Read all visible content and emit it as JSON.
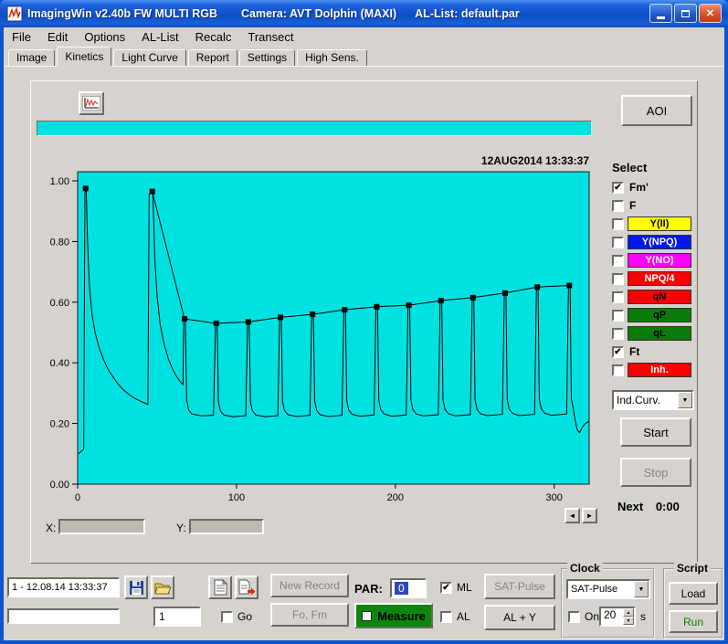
{
  "window": {
    "title": "ImagingWin v2.40b  FW MULTI RGB",
    "camera": "Camera: AVT Dolphin (MAXI)",
    "al_list": "AL-List: default.par"
  },
  "menu": {
    "items": [
      "File",
      "Edit",
      "Options",
      "AL-List",
      "Recalc",
      "Transect"
    ]
  },
  "tabs": {
    "items": [
      "Image",
      "Kinetics",
      "Light Curve",
      "Report",
      "Settings",
      "High Sens."
    ],
    "active": "Kinetics"
  },
  "toolbar": {
    "aoi_label": "AOI"
  },
  "chart_data": {
    "type": "line",
    "timestamp": "12AUG2014  13:33:37",
    "plot_bg": "#00E2E2",
    "xlim": [
      0,
      322
    ],
    "ylim": [
      0,
      1.0
    ],
    "x_ticks": [
      [
        0,
        "0"
      ],
      [
        100,
        "100"
      ],
      [
        200,
        "200"
      ],
      [
        300,
        "300"
      ]
    ],
    "y_ticks": [
      [
        0,
        "0.00"
      ],
      [
        0.2,
        "0.20"
      ],
      [
        0.4,
        "0.40"
      ],
      [
        0.6,
        "0.60"
      ],
      [
        0.8,
        "0.80"
      ],
      [
        1.0,
        "1.00"
      ]
    ],
    "series_names": [
      "Fm'",
      "Ft"
    ],
    "fm_line_from": 1,
    "fm_points": [
      [
        5,
        0.975
      ],
      [
        47,
        0.965
      ],
      [
        67.3,
        0.545
      ],
      [
        87.3,
        0.53
      ],
      [
        107.5,
        0.535
      ],
      [
        127.7,
        0.55
      ],
      [
        147.9,
        0.56
      ],
      [
        168.1,
        0.575
      ],
      [
        188.3,
        0.585
      ],
      [
        208.5,
        0.59
      ],
      [
        228.7,
        0.605
      ],
      [
        248.9,
        0.615
      ],
      [
        269.1,
        0.63
      ],
      [
        289.3,
        0.65
      ],
      [
        309.5,
        0.655
      ]
    ],
    "ft_trace": [
      [
        0.5,
        0.1
      ],
      [
        3.8,
        0.115
      ],
      [
        4.6,
        0.96
      ],
      [
        5.4,
        0.975
      ],
      [
        6.2,
        0.8
      ],
      [
        7.5,
        0.65
      ],
      [
        9,
        0.56
      ],
      [
        11,
        0.5
      ],
      [
        13.5,
        0.45
      ],
      [
        16,
        0.415
      ],
      [
        19,
        0.38
      ],
      [
        22,
        0.355
      ],
      [
        25.5,
        0.33
      ],
      [
        29,
        0.31
      ],
      [
        33,
        0.293
      ],
      [
        37,
        0.28
      ],
      [
        41,
        0.27
      ],
      [
        44.2,
        0.263
      ],
      [
        45.0,
        0.955
      ],
      [
        46.2,
        0.965
      ],
      [
        47.4,
        0.955
      ],
      [
        48.6,
        0.74
      ],
      [
        50,
        0.62
      ],
      [
        52,
        0.525
      ],
      [
        54.5,
        0.46
      ],
      [
        57,
        0.415
      ],
      [
        59.5,
        0.382
      ],
      [
        62,
        0.357
      ],
      [
        64.5,
        0.338
      ],
      [
        66.3,
        0.328
      ],
      [
        66.8,
        0.545
      ],
      [
        67.8,
        0.545
      ],
      [
        68.6,
        0.28
      ],
      [
        69.8,
        0.245
      ],
      [
        72,
        0.231
      ],
      [
        78,
        0.225
      ],
      [
        85.5,
        0.227
      ],
      [
        86.8,
        0.53
      ],
      [
        87.8,
        0.53
      ],
      [
        88.6,
        0.272
      ],
      [
        89.8,
        0.242
      ],
      [
        92,
        0.228
      ],
      [
        98,
        0.222
      ],
      [
        105.8,
        0.226
      ],
      [
        107.0,
        0.535
      ],
      [
        108.0,
        0.535
      ],
      [
        108.8,
        0.272
      ],
      [
        110,
        0.242
      ],
      [
        112.2,
        0.228
      ],
      [
        118,
        0.222
      ],
      [
        126,
        0.226
      ],
      [
        127.2,
        0.55
      ],
      [
        128.2,
        0.55
      ],
      [
        129,
        0.274
      ],
      [
        130.2,
        0.243
      ],
      [
        132.4,
        0.229
      ],
      [
        138,
        0.223
      ],
      [
        146.2,
        0.227
      ],
      [
        147.4,
        0.56
      ],
      [
        148.4,
        0.56
      ],
      [
        149.2,
        0.275
      ],
      [
        150.4,
        0.244
      ],
      [
        152.6,
        0.229
      ],
      [
        158,
        0.223
      ],
      [
        166.4,
        0.227
      ],
      [
        167.6,
        0.575
      ],
      [
        168.6,
        0.575
      ],
      [
        169.4,
        0.276
      ],
      [
        170.6,
        0.245
      ],
      [
        172.8,
        0.23
      ],
      [
        178,
        0.224
      ],
      [
        186.6,
        0.228
      ],
      [
        187.8,
        0.585
      ],
      [
        188.8,
        0.585
      ],
      [
        189.6,
        0.277
      ],
      [
        190.8,
        0.246
      ],
      [
        193,
        0.231
      ],
      [
        198,
        0.224
      ],
      [
        206.8,
        0.228
      ],
      [
        208.0,
        0.59
      ],
      [
        209.0,
        0.59
      ],
      [
        209.8,
        0.277
      ],
      [
        211,
        0.246
      ],
      [
        213.2,
        0.231
      ],
      [
        218,
        0.225
      ],
      [
        227,
        0.229
      ],
      [
        228.2,
        0.605
      ],
      [
        229.2,
        0.605
      ],
      [
        230,
        0.278
      ],
      [
        231.2,
        0.247
      ],
      [
        233.4,
        0.232
      ],
      [
        238,
        0.225
      ],
      [
        247.2,
        0.229
      ],
      [
        248.4,
        0.615
      ],
      [
        249.4,
        0.615
      ],
      [
        250.2,
        0.279
      ],
      [
        251.4,
        0.247
      ],
      [
        253.6,
        0.232
      ],
      [
        258,
        0.226
      ],
      [
        267.4,
        0.23
      ],
      [
        268.6,
        0.63
      ],
      [
        269.6,
        0.63
      ],
      [
        270.4,
        0.28
      ],
      [
        271.6,
        0.248
      ],
      [
        273.8,
        0.233
      ],
      [
        278,
        0.226
      ],
      [
        287.6,
        0.23
      ],
      [
        288.8,
        0.65
      ],
      [
        289.8,
        0.65
      ],
      [
        290.6,
        0.281
      ],
      [
        291.8,
        0.249
      ],
      [
        294,
        0.234
      ],
      [
        298,
        0.227
      ],
      [
        307.8,
        0.231
      ],
      [
        309.0,
        0.655
      ],
      [
        310.0,
        0.655
      ],
      [
        310.8,
        0.282
      ],
      [
        312,
        0.25
      ],
      [
        313.2,
        0.21
      ],
      [
        314.5,
        0.178
      ],
      [
        316,
        0.17
      ],
      [
        317.5,
        0.186
      ],
      [
        319.5,
        0.2
      ],
      [
        322,
        0.207
      ]
    ]
  },
  "select_panel": {
    "title": "Select",
    "items": [
      {
        "label": "Fm'",
        "checked": true,
        "bg": null,
        "fg": "#000000"
      },
      {
        "label": "F",
        "checked": false,
        "bg": null,
        "fg": "#000000"
      },
      {
        "label": "Y(II)",
        "checked": false,
        "bg": "#FFFF00",
        "fg": "#000000"
      },
      {
        "label": "Y(NPQ)",
        "checked": false,
        "bg": "#0018EA",
        "fg": "#FFFFFF"
      },
      {
        "label": "Y(NO)",
        "checked": false,
        "bg": "#FF00FF",
        "fg": "#FFFFFF"
      },
      {
        "label": "NPQ/4",
        "checked": false,
        "bg": "#FF0000",
        "fg": "#FFFFFF"
      },
      {
        "label": "qN",
        "checked": false,
        "bg": "#FF0000",
        "fg": "#000000"
      },
      {
        "label": "qP",
        "checked": false,
        "bg": "#0B7B0B",
        "fg": "#000000"
      },
      {
        "label": "qL",
        "checked": false,
        "bg": "#0B7B0B",
        "fg": "#000000"
      },
      {
        "label": "Ft",
        "checked": true,
        "bg": null,
        "fg": "#000000"
      },
      {
        "label": "Inh.",
        "checked": false,
        "bg": "#FF0000",
        "fg": "#FFFFFF"
      }
    ]
  },
  "controls": {
    "mode_dropdown": "Ind.Curv.",
    "start": "Start",
    "stop": "Stop",
    "next_label": "Next",
    "next_value": "0:00",
    "x_label": "X:",
    "y_label": "Y:"
  },
  "bottom": {
    "record_text": "1 - 12.08.14 13:33:37",
    "record_number": "1",
    "go_label": "Go",
    "new_record": "New Record",
    "fo_fm": "Fo, Fm",
    "par_label": "PAR:",
    "par_value": "0",
    "ml_label": "ML",
    "al_label": "AL",
    "measure": "Measure",
    "sat_pulse": "SAT-Pulse",
    "al_y": "AL + Y",
    "clock": {
      "title": "Clock",
      "mode": "SAT-Pulse",
      "on_label": "On",
      "interval": "20",
      "unit": "s"
    },
    "script": {
      "title": "Script",
      "load": "Load",
      "run": "Run"
    }
  },
  "colors": {
    "cyan": "#00E2E2",
    "measure_green": "#0C860C",
    "run_green": "#0A7D0A"
  }
}
